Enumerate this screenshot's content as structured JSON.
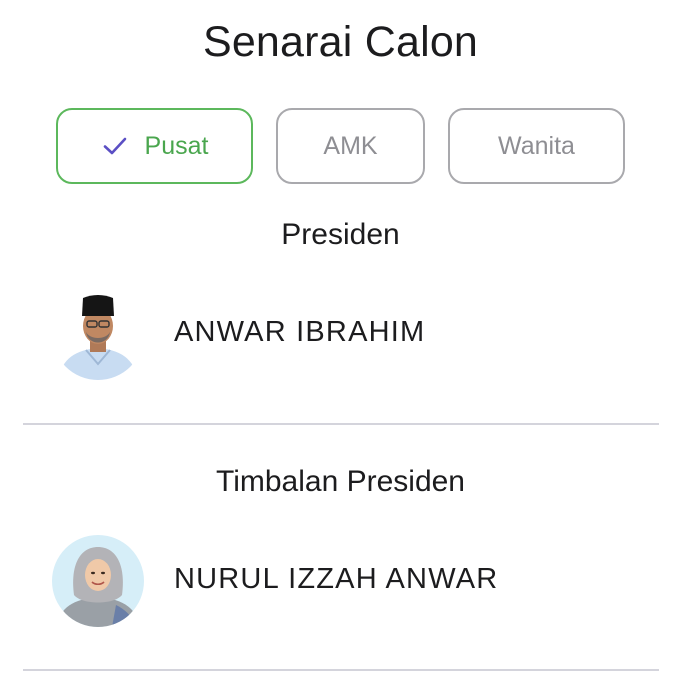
{
  "page": {
    "title": "Senarai Calon"
  },
  "tabs": [
    {
      "label": "Pusat",
      "selected": true,
      "icon": "check-icon"
    },
    {
      "label": "AMK",
      "selected": false
    },
    {
      "label": "Wanita",
      "selected": false
    }
  ],
  "sections": [
    {
      "heading": "Presiden",
      "candidates": [
        {
          "name": "ANWAR IBRAHIM",
          "avatar": "avatar-photo"
        }
      ]
    },
    {
      "heading": "Timbalan Presiden",
      "candidates": [
        {
          "name": "NURUL IZZAH ANWAR",
          "avatar": "avatar-photo"
        }
      ]
    }
  ],
  "colors": {
    "selected_border": "#5cb85c",
    "selected_text": "#4aa64e",
    "check_icon": "#5b4fc4",
    "unselected_border": "#a9a9ad",
    "unselected_text": "#8e8e93",
    "divider": "#d4d4dc"
  }
}
